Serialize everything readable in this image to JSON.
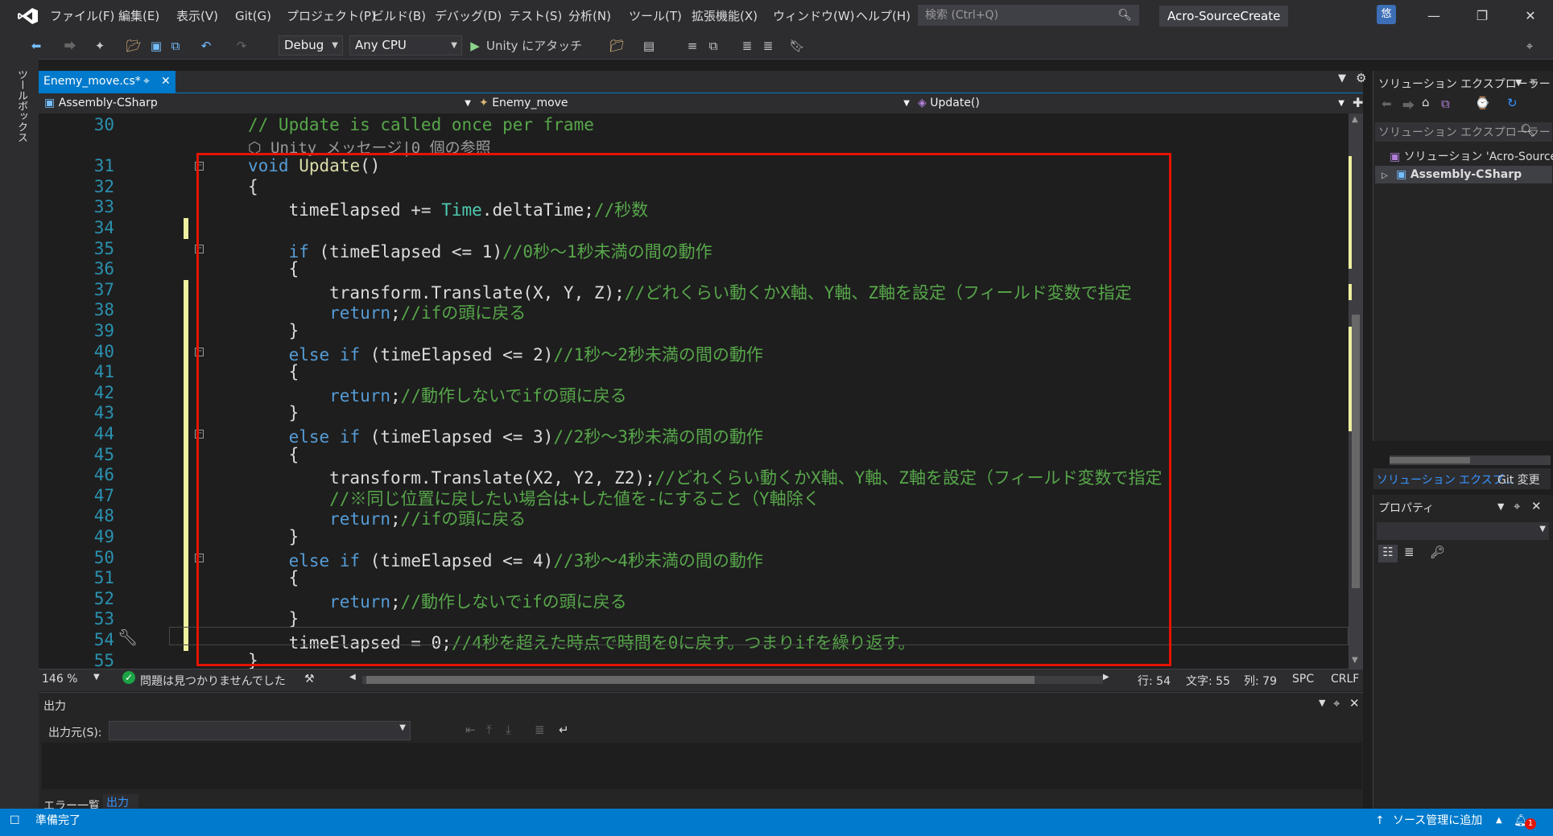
{
  "menu": [
    "ファイル(F)",
    "編集(E)",
    "表示(V)",
    "Git(G)",
    "プロジェクト(P)",
    "ビルド(B)",
    "デバッグ(D)",
    "テスト(S)",
    "分析(N)",
    "ツール(T)",
    "拡張機能(X)",
    "ウィンドウ(W)",
    "ヘルプ(H)"
  ],
  "search": {
    "placeholder": "検索 (Ctrl+Q)"
  },
  "project_name": "Acro-SourceCreate",
  "avatar": "悠",
  "toolbar": {
    "config": "Debug",
    "platform": "Any CPU",
    "attach": "Unity にアタッチ"
  },
  "toolbox_label": "ツールボックス",
  "tab": {
    "label": "Enemy_move.cs*"
  },
  "nav": {
    "assembly": "Assembly-CSharp",
    "class": "Enemy_move",
    "member": "Update()"
  },
  "code_lines": [
    {
      "n": "30",
      "code": "// Update is called once per frame"
    },
    {
      "n": "",
      "code": "Unity メッセージ|0 個の参照"
    },
    {
      "n": "31",
      "code": "void Update()"
    },
    {
      "n": "32",
      "code": "{"
    },
    {
      "n": "33",
      "code": "    timeElapsed += Time.deltaTime;//秒数"
    },
    {
      "n": "34",
      "code": ""
    },
    {
      "n": "35",
      "code": "    if (timeElapsed <= 1)//0秒～1秒未満の間の動作"
    },
    {
      "n": "36",
      "code": "    {"
    },
    {
      "n": "37",
      "code": "        transform.Translate(X, Y, Z);//どれくらい動くかX軸、Y軸、Z軸を設定（フィールド変数で指定"
    },
    {
      "n": "38",
      "code": "        return;//ifの頭に戻る"
    },
    {
      "n": "39",
      "code": "    }"
    },
    {
      "n": "40",
      "code": "    else if (timeElapsed <= 2)//1秒～2秒未満の間の動作"
    },
    {
      "n": "41",
      "code": "    {"
    },
    {
      "n": "42",
      "code": "        return;//動作しないでifの頭に戻る"
    },
    {
      "n": "43",
      "code": "    }"
    },
    {
      "n": "44",
      "code": "    else if (timeElapsed <= 3)//2秒～3秒未満の間の動作"
    },
    {
      "n": "45",
      "code": "    {"
    },
    {
      "n": "46",
      "code": "        transform.Translate(X2, Y2, Z2);//どれくらい動くかX軸、Y軸、Z軸を設定（フィールド変数で指定"
    },
    {
      "n": "47",
      "code": "        //※同じ位置に戻したい場合は+した値を-にすること（Y軸除く"
    },
    {
      "n": "48",
      "code": "        return;//ifの頭に戻る"
    },
    {
      "n": "49",
      "code": "    }"
    },
    {
      "n": "50",
      "code": "    else if (timeElapsed <= 4)//3秒～4秒未満の間の動作"
    },
    {
      "n": "51",
      "code": "    {"
    },
    {
      "n": "52",
      "code": "        return;//動作しないでifの頭に戻る"
    },
    {
      "n": "53",
      "code": "    }"
    },
    {
      "n": "54",
      "code": "    timeElapsed = 0;//4秒を超えた時点で時間を0に戻す。つまりifを繰り返す。"
    },
    {
      "n": "55",
      "code": "}"
    }
  ],
  "editor_status": {
    "zoom": "146 %",
    "issues": "問題は見つかりませんでした",
    "line": "行: 54",
    "char": "文字: 55",
    "col": "列: 79",
    "spc": "SPC",
    "crlf": "CRLF"
  },
  "output": {
    "title": "出力",
    "source_label": "出力元(S):",
    "tab_errors": "エラー一覧",
    "tab_output": "出力"
  },
  "solution": {
    "title": "ソリューション エクスプローラー",
    "search": "ソリューション エクスプローラー",
    "item_solution": "ソリューション 'Acro-SourceCr",
    "item_project": "Assembly-CSharp",
    "tab_solution": "ソリューション エクスプ...",
    "tab_git": "Git 変更"
  },
  "properties": {
    "title": "プロパティ"
  },
  "status": {
    "ready": "準備完了",
    "source_control": "ソース管理に追加",
    "notifications": "1"
  }
}
